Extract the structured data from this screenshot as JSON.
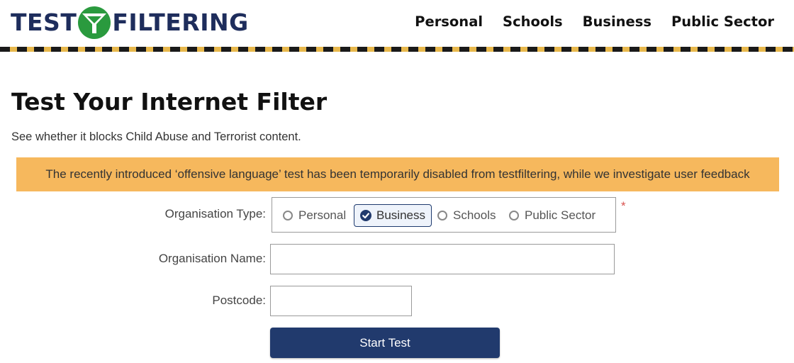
{
  "brand": {
    "logo_left": "TEST",
    "logo_right": "FILTERING",
    "logo_icon": "funnel-y-icon",
    "colors": {
      "navy": "#1e2d5c",
      "green": "#2a9a3e",
      "stripe_gold": "#e8b84d"
    }
  },
  "nav": {
    "items": [
      "Personal",
      "Schools",
      "Business",
      "Public Sector"
    ]
  },
  "intro": {
    "title": "Test Your Internet Filter",
    "subtitle": "See whether it blocks Child Abuse and Terrorist content."
  },
  "notice": {
    "text": "The recently introduced ‘offensive language’ test has been temporarily disabled from testfiltering, while we investigate user feedback",
    "color": "#f6b85d"
  },
  "form": {
    "org_type_label": "Organisation Type:",
    "org_types": [
      "Personal",
      "Business",
      "Schools",
      "Public Sector"
    ],
    "selected_org_type": "Business",
    "required_marker": "*",
    "org_name_label": "Organisation Name:",
    "org_name_value": "",
    "postcode_label": "Postcode:",
    "postcode_value": "",
    "submit_label": "Start Test"
  }
}
